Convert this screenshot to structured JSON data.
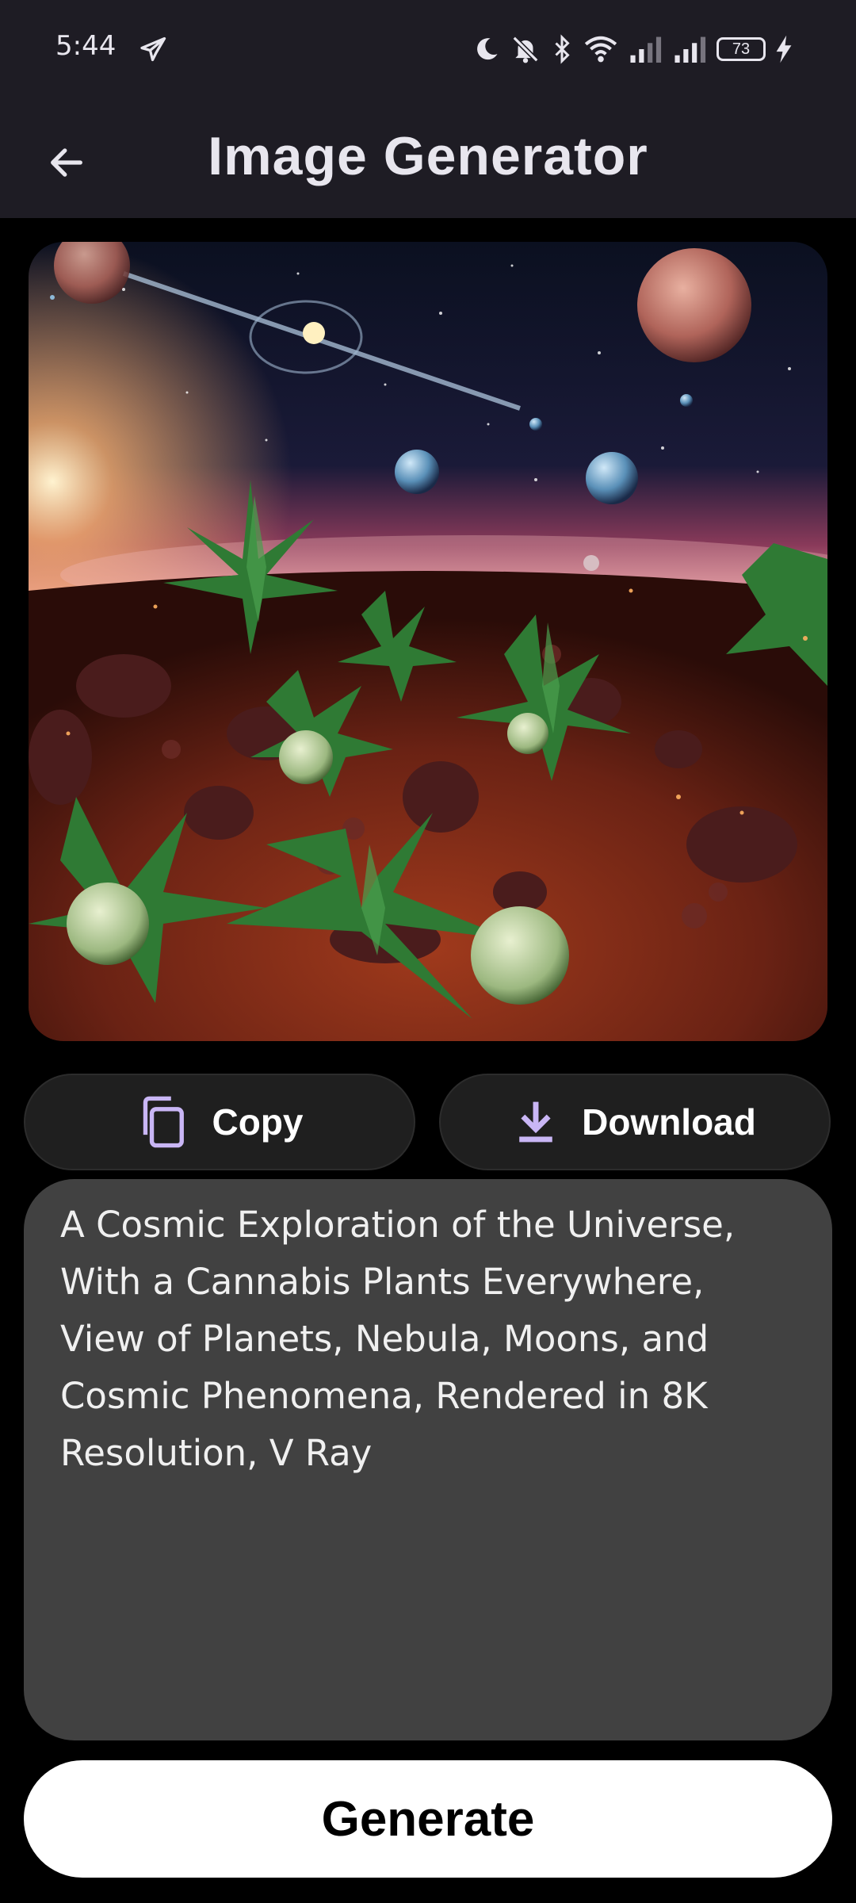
{
  "status_bar": {
    "time": "5:44",
    "battery_level": "73",
    "icons": [
      "telegram-icon",
      "moon-icon",
      "bell-off-icon",
      "bluetooth-icon",
      "wifi-icon",
      "signal-icon",
      "signal-icon",
      "battery-icon",
      "charging-icon"
    ]
  },
  "app_bar": {
    "title": "Image Generator",
    "back_icon": "arrow-left-icon"
  },
  "image": {
    "alt": "Generated image of cannabis plants on a cosmic planet surface with planets and nebula"
  },
  "actions": {
    "copy_label": "Copy",
    "download_label": "Download",
    "copy_icon": "copy-icon",
    "download_icon": "download-icon"
  },
  "prompt": {
    "text": "A Cosmic Exploration of the Universe, With a Cannabis Plants Everywhere, View of Planets, Nebula, Moons, and Cosmic Phenomena, Rendered in 8K Resolution, V Ray"
  },
  "generate": {
    "label": "Generate"
  },
  "colors": {
    "bar_background": "#1e1c24",
    "page_background": "#000000",
    "accent": "#c9b6f5",
    "prompt_background": "#414141",
    "button_background": "#1f1f1f"
  }
}
